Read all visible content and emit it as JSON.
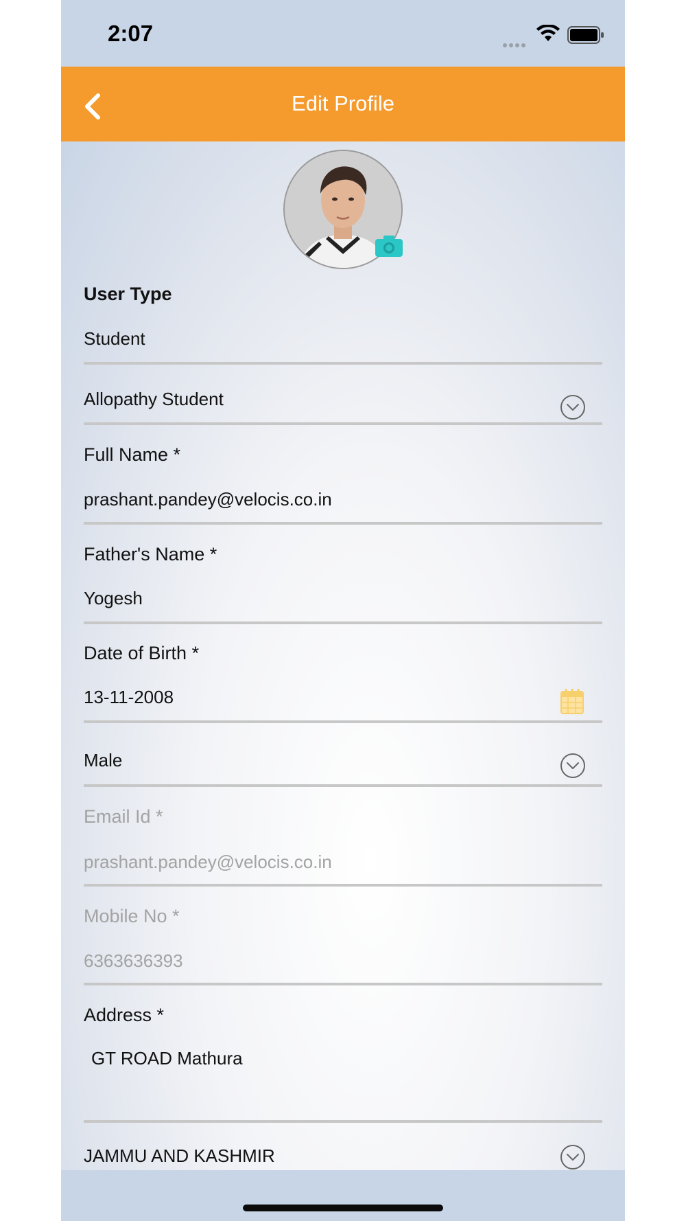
{
  "status_bar": {
    "time": "2:07"
  },
  "header": {
    "title": "Edit Profile"
  },
  "form": {
    "user_type_label": "User Type",
    "user_type_value": "Student",
    "student_category": "Allopathy Student",
    "full_name_label": "Full Name *",
    "full_name_value": "prashant.pandey@velocis.co.in",
    "father_name_label": "Father's Name *",
    "father_name_value": "Yogesh",
    "dob_label": "Date of Birth *",
    "dob_value": "13-11-2008",
    "gender_value": "Male",
    "email_label": "Email Id *",
    "email_value": "prashant.pandey@velocis.co.in",
    "mobile_label": "Mobile No *",
    "mobile_value": "6363636393",
    "address_label": "Address *",
    "address_value": "GT ROAD Mathura",
    "state_value": "JAMMU AND KASHMIR"
  },
  "colors": {
    "header": "#f59a2d",
    "background": "#c8d5e6",
    "camera_accent": "#2bc6c6",
    "calendar_accent": "#f7cf6b"
  },
  "icons": [
    "back-arrow-icon",
    "camera-icon",
    "chevron-down-icon",
    "calendar-icon",
    "wifi-icon",
    "battery-icon",
    "signal-icon"
  ]
}
